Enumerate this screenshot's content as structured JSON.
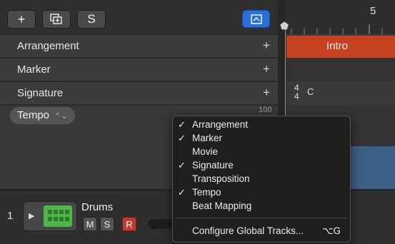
{
  "toolbar": {
    "add": "+",
    "s": "S"
  },
  "global_tracks": [
    {
      "label": "Arrangement"
    },
    {
      "label": "Marker"
    },
    {
      "label": "Signature"
    },
    {
      "label": "Tempo"
    }
  ],
  "tempo_value": "100",
  "timeline": {
    "bar_number": "5",
    "arrangement_region": "Intro",
    "signature": {
      "top": "4",
      "bottom": "4",
      "key": "C"
    }
  },
  "track": {
    "number": "1",
    "name": "Drums",
    "mute": "M",
    "solo": "S",
    "record": "R"
  },
  "menu": {
    "items": [
      {
        "label": "Arrangement",
        "checked": true
      },
      {
        "label": "Marker",
        "checked": true
      },
      {
        "label": "Movie",
        "checked": false
      },
      {
        "label": "Signature",
        "checked": true
      },
      {
        "label": "Transposition",
        "checked": false
      },
      {
        "label": "Tempo",
        "checked": true
      },
      {
        "label": "Beat Mapping",
        "checked": false
      }
    ],
    "configure": {
      "label": "Configure Global Tracks...",
      "shortcut": "⌥G"
    }
  },
  "colors": {
    "accent": "#2a6fd8",
    "arrangement_region": "#c6421f",
    "record": "#c03a32",
    "instrument_icon": "#4fb64a"
  }
}
